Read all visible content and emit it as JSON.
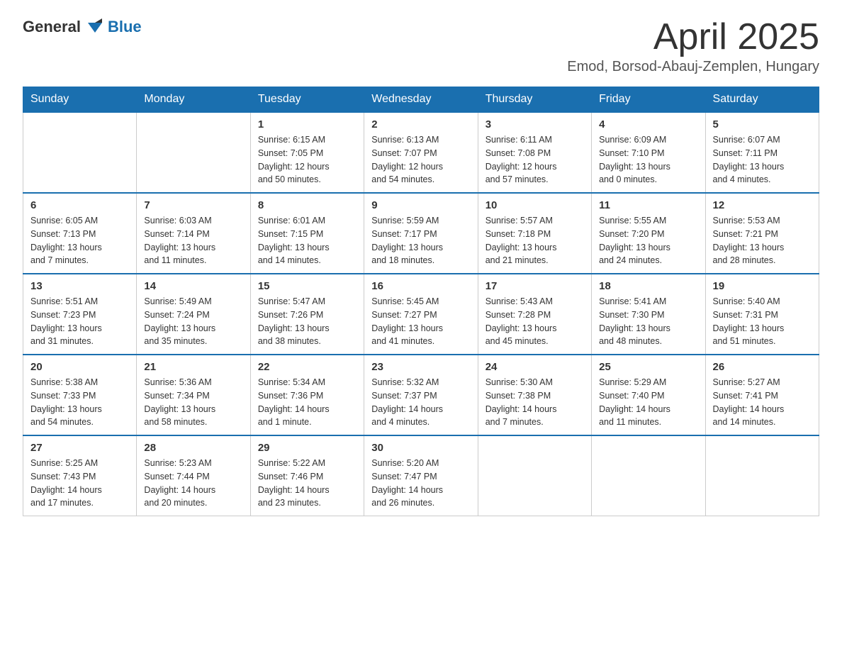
{
  "header": {
    "logo_general": "General",
    "logo_blue": "Blue",
    "month_title": "April 2025",
    "location": "Emod, Borsod-Abauj-Zemplen, Hungary"
  },
  "weekdays": [
    "Sunday",
    "Monday",
    "Tuesday",
    "Wednesday",
    "Thursday",
    "Friday",
    "Saturday"
  ],
  "weeks": [
    [
      {
        "day": "",
        "info": ""
      },
      {
        "day": "",
        "info": ""
      },
      {
        "day": "1",
        "info": "Sunrise: 6:15 AM\nSunset: 7:05 PM\nDaylight: 12 hours\nand 50 minutes."
      },
      {
        "day": "2",
        "info": "Sunrise: 6:13 AM\nSunset: 7:07 PM\nDaylight: 12 hours\nand 54 minutes."
      },
      {
        "day": "3",
        "info": "Sunrise: 6:11 AM\nSunset: 7:08 PM\nDaylight: 12 hours\nand 57 minutes."
      },
      {
        "day": "4",
        "info": "Sunrise: 6:09 AM\nSunset: 7:10 PM\nDaylight: 13 hours\nand 0 minutes."
      },
      {
        "day": "5",
        "info": "Sunrise: 6:07 AM\nSunset: 7:11 PM\nDaylight: 13 hours\nand 4 minutes."
      }
    ],
    [
      {
        "day": "6",
        "info": "Sunrise: 6:05 AM\nSunset: 7:13 PM\nDaylight: 13 hours\nand 7 minutes."
      },
      {
        "day": "7",
        "info": "Sunrise: 6:03 AM\nSunset: 7:14 PM\nDaylight: 13 hours\nand 11 minutes."
      },
      {
        "day": "8",
        "info": "Sunrise: 6:01 AM\nSunset: 7:15 PM\nDaylight: 13 hours\nand 14 minutes."
      },
      {
        "day": "9",
        "info": "Sunrise: 5:59 AM\nSunset: 7:17 PM\nDaylight: 13 hours\nand 18 minutes."
      },
      {
        "day": "10",
        "info": "Sunrise: 5:57 AM\nSunset: 7:18 PM\nDaylight: 13 hours\nand 21 minutes."
      },
      {
        "day": "11",
        "info": "Sunrise: 5:55 AM\nSunset: 7:20 PM\nDaylight: 13 hours\nand 24 minutes."
      },
      {
        "day": "12",
        "info": "Sunrise: 5:53 AM\nSunset: 7:21 PM\nDaylight: 13 hours\nand 28 minutes."
      }
    ],
    [
      {
        "day": "13",
        "info": "Sunrise: 5:51 AM\nSunset: 7:23 PM\nDaylight: 13 hours\nand 31 minutes."
      },
      {
        "day": "14",
        "info": "Sunrise: 5:49 AM\nSunset: 7:24 PM\nDaylight: 13 hours\nand 35 minutes."
      },
      {
        "day": "15",
        "info": "Sunrise: 5:47 AM\nSunset: 7:26 PM\nDaylight: 13 hours\nand 38 minutes."
      },
      {
        "day": "16",
        "info": "Sunrise: 5:45 AM\nSunset: 7:27 PM\nDaylight: 13 hours\nand 41 minutes."
      },
      {
        "day": "17",
        "info": "Sunrise: 5:43 AM\nSunset: 7:28 PM\nDaylight: 13 hours\nand 45 minutes."
      },
      {
        "day": "18",
        "info": "Sunrise: 5:41 AM\nSunset: 7:30 PM\nDaylight: 13 hours\nand 48 minutes."
      },
      {
        "day": "19",
        "info": "Sunrise: 5:40 AM\nSunset: 7:31 PM\nDaylight: 13 hours\nand 51 minutes."
      }
    ],
    [
      {
        "day": "20",
        "info": "Sunrise: 5:38 AM\nSunset: 7:33 PM\nDaylight: 13 hours\nand 54 minutes."
      },
      {
        "day": "21",
        "info": "Sunrise: 5:36 AM\nSunset: 7:34 PM\nDaylight: 13 hours\nand 58 minutes."
      },
      {
        "day": "22",
        "info": "Sunrise: 5:34 AM\nSunset: 7:36 PM\nDaylight: 14 hours\nand 1 minute."
      },
      {
        "day": "23",
        "info": "Sunrise: 5:32 AM\nSunset: 7:37 PM\nDaylight: 14 hours\nand 4 minutes."
      },
      {
        "day": "24",
        "info": "Sunrise: 5:30 AM\nSunset: 7:38 PM\nDaylight: 14 hours\nand 7 minutes."
      },
      {
        "day": "25",
        "info": "Sunrise: 5:29 AM\nSunset: 7:40 PM\nDaylight: 14 hours\nand 11 minutes."
      },
      {
        "day": "26",
        "info": "Sunrise: 5:27 AM\nSunset: 7:41 PM\nDaylight: 14 hours\nand 14 minutes."
      }
    ],
    [
      {
        "day": "27",
        "info": "Sunrise: 5:25 AM\nSunset: 7:43 PM\nDaylight: 14 hours\nand 17 minutes."
      },
      {
        "day": "28",
        "info": "Sunrise: 5:23 AM\nSunset: 7:44 PM\nDaylight: 14 hours\nand 20 minutes."
      },
      {
        "day": "29",
        "info": "Sunrise: 5:22 AM\nSunset: 7:46 PM\nDaylight: 14 hours\nand 23 minutes."
      },
      {
        "day": "30",
        "info": "Sunrise: 5:20 AM\nSunset: 7:47 PM\nDaylight: 14 hours\nand 26 minutes."
      },
      {
        "day": "",
        "info": ""
      },
      {
        "day": "",
        "info": ""
      },
      {
        "day": "",
        "info": ""
      }
    ]
  ]
}
